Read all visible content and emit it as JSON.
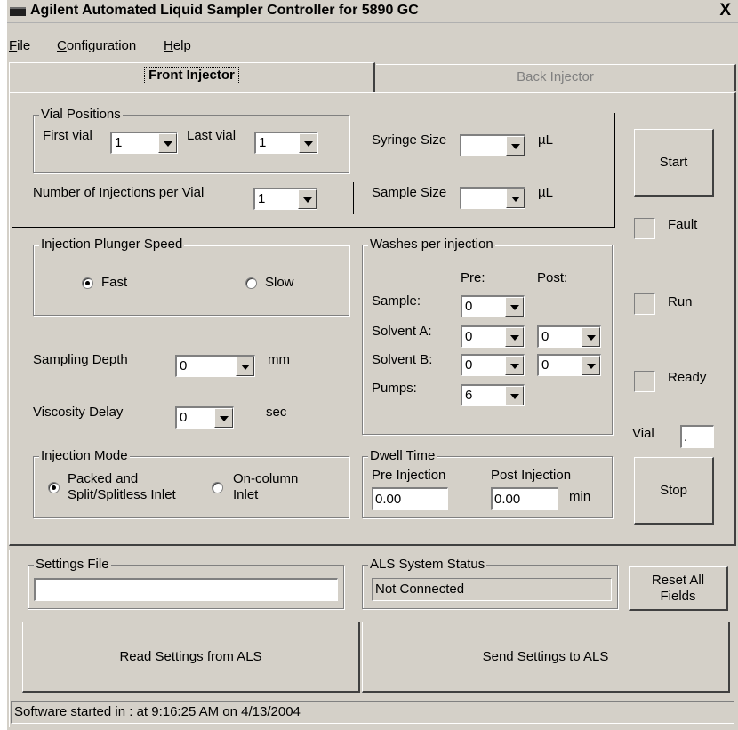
{
  "window": {
    "title": "Agilent Automated Liquid Sampler Controller for 5890 GC",
    "close": "X"
  },
  "menu": {
    "file": "File",
    "configuration": "Configuration",
    "help": "Help"
  },
  "tabs": {
    "front": "Front Injector",
    "back": "Back Injector"
  },
  "vial_positions": {
    "title": "Vial Positions",
    "first_label": "First vial",
    "first_value": "1",
    "last_label": "Last vial",
    "last_value": "1"
  },
  "injections": {
    "label": "Number of Injections per Vial",
    "value": "1"
  },
  "syringe": {
    "label": "Syringe Size",
    "value": "",
    "unit": "µL"
  },
  "sample": {
    "label": "Sample Size",
    "value": "",
    "unit": "µL"
  },
  "plunger": {
    "title": "Injection Plunger Speed",
    "fast": "Fast",
    "slow": "Slow",
    "selected": "Fast"
  },
  "sampling_depth": {
    "label": "Sampling Depth",
    "value": "0",
    "unit": "mm"
  },
  "viscosity": {
    "label": "Viscosity Delay",
    "value": "0",
    "unit": "sec"
  },
  "injection_mode": {
    "title": "Injection Mode",
    "packed_line1": "Packed and",
    "packed_line2": "Split/Splitless Inlet",
    "oncol_line1": "On-column",
    "oncol_line2": "Inlet",
    "selected": "packed"
  },
  "washes": {
    "title": "Washes per injection",
    "pre_header": "Pre:",
    "post_header": "Post:",
    "sample_label": "Sample:",
    "sample_pre": "0",
    "solvent_a_label": "Solvent A:",
    "solvent_a_pre": "0",
    "solvent_a_post": "0",
    "solvent_b_label": "Solvent B:",
    "solvent_b_pre": "0",
    "solvent_b_post": "0",
    "pumps_label": "Pumps:",
    "pumps_value": "6"
  },
  "dwell": {
    "title": "Dwell Time",
    "pre_label": "Pre Injection",
    "pre_value": "0.00",
    "post_label": "Post Injection",
    "post_value": "0.00",
    "unit": "min"
  },
  "side": {
    "start": "Start",
    "fault": "Fault",
    "run": "Run",
    "ready": "Ready",
    "vial_label": "Vial",
    "vial_value": ".",
    "stop": "Stop"
  },
  "settings_file": {
    "title": "Settings File",
    "value": ""
  },
  "als_status": {
    "title": "ALS System Status",
    "value": "Not Connected"
  },
  "reset": {
    "line1": "Reset All",
    "line2": "Fields"
  },
  "read_settings": "Read Settings from ALS",
  "send_settings": "Send Settings to ALS",
  "status_bar": "Software started in : at 9:16:25 AM on 4/13/2004"
}
